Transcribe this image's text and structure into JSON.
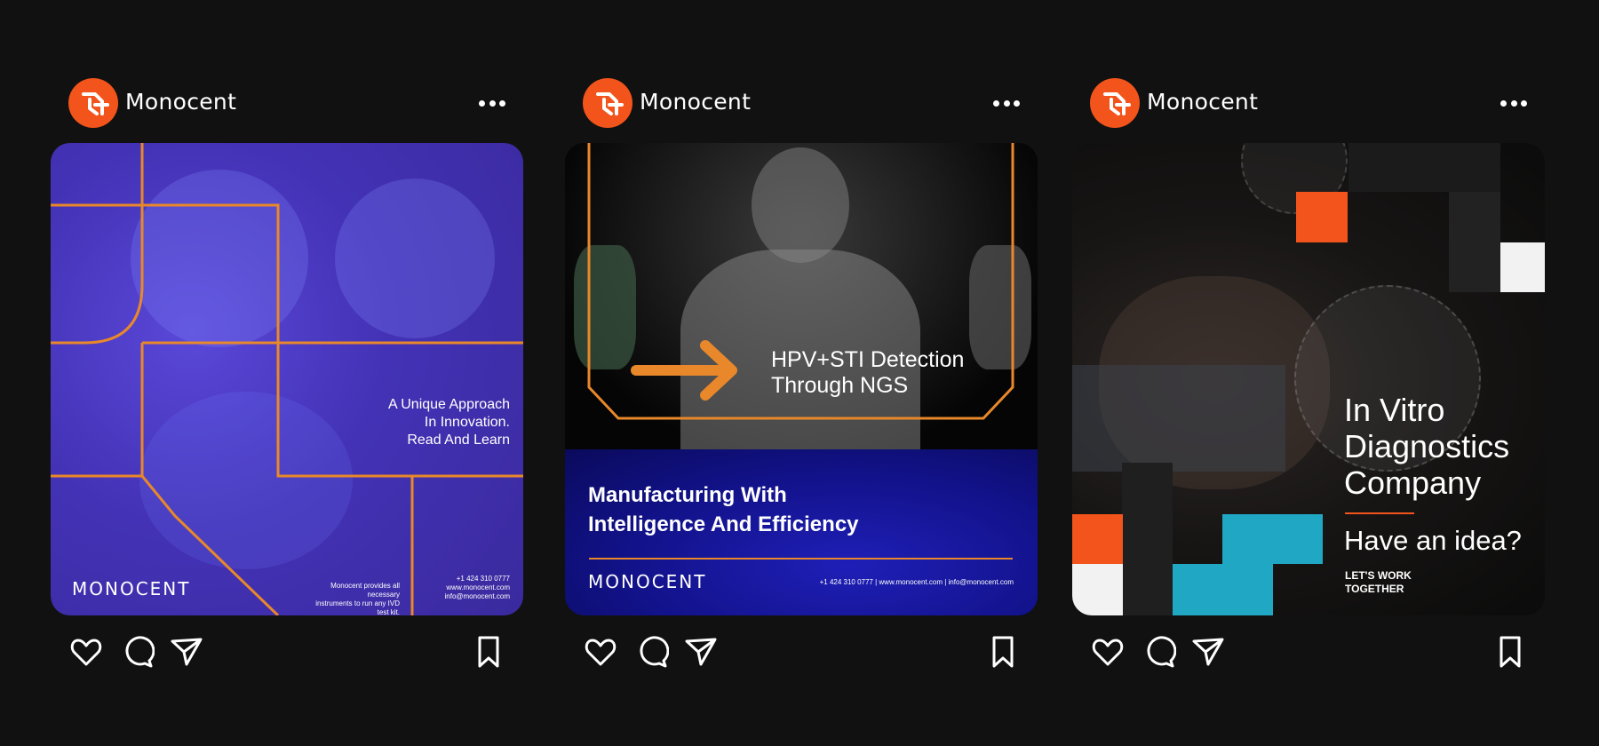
{
  "posts": [
    {
      "username": "Monocent",
      "image": {
        "caption_lines": [
          "A Unique Approach",
          "In Innovation.",
          "Read And Learn"
        ],
        "logo": "MONOCENT",
        "footer_lines": [
          "Monocent provides all necessary",
          "instruments to run any IVD test kit."
        ],
        "contact_lines": [
          "+1 424 310 0777",
          "www.monocent.com",
          "info@monocent.com"
        ]
      }
    },
    {
      "username": "Monocent",
      "image": {
        "overlay_lines": [
          "HPV+STI Detection",
          "Through NGS"
        ],
        "headline_lines": [
          "Manufacturing With",
          "Intelligence And Efficiency"
        ],
        "logo": "MONOCENT",
        "contact": "+1 424 310 0777   |   www.monocent.com   |   info@monocent.com"
      }
    },
    {
      "username": "Monocent",
      "image": {
        "title_lines": [
          "In Vitro",
          "Diagnostics",
          "Company"
        ],
        "idea": "Have an idea?",
        "cta_lines": [
          "LET'S WORK",
          "TOGETHER"
        ]
      }
    }
  ],
  "icons": {
    "avatar": "monocent-logo-icon",
    "more": "more-options-icon",
    "like": "heart-icon",
    "comment": "comment-icon",
    "share": "paper-plane-icon",
    "save": "bookmark-icon"
  },
  "colors": {
    "background": "#111111",
    "brand_orange": "#f2541b",
    "accent_orange": "#e8882a",
    "purple": "#4332b5",
    "navy": "#12128a",
    "teal": "#1fa7c4"
  }
}
